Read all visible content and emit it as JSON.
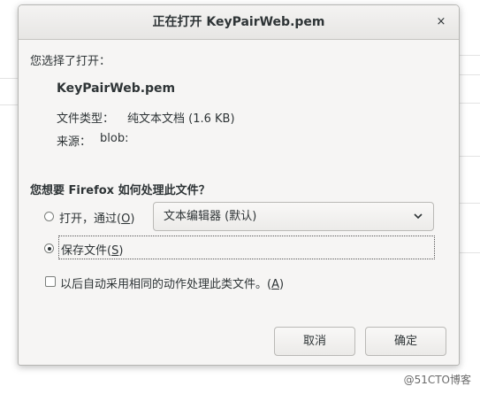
{
  "dialog": {
    "title": "正在打开 KeyPairWeb.pem",
    "close_glyph": "×",
    "intro": "您选择了打开：",
    "filename": "KeyPairWeb.pem",
    "file_type_label": "文件类型：",
    "file_type_value": "纯文本文档 (1.6 KB)",
    "source_label": "来源：",
    "source_value": "blob:",
    "question": "您想要 Firefox 如何处理此文件？",
    "open_with": {
      "label_pre": "打开，通过(",
      "accel": "O",
      "label_post": ")",
      "selected": false
    },
    "app_select": {
      "value": "文本编辑器 (默认)"
    },
    "save_file": {
      "label_pre": "保存文件(",
      "accel": "S",
      "label_post": ")",
      "selected": true
    },
    "remember": {
      "label_pre": "以后自动采用相同的动作处理此类文件。(",
      "accel": "A",
      "label_post": ")",
      "checked": false
    },
    "cancel_label": "取消",
    "ok_label": "确定"
  },
  "watermark": "@51CTO博客"
}
